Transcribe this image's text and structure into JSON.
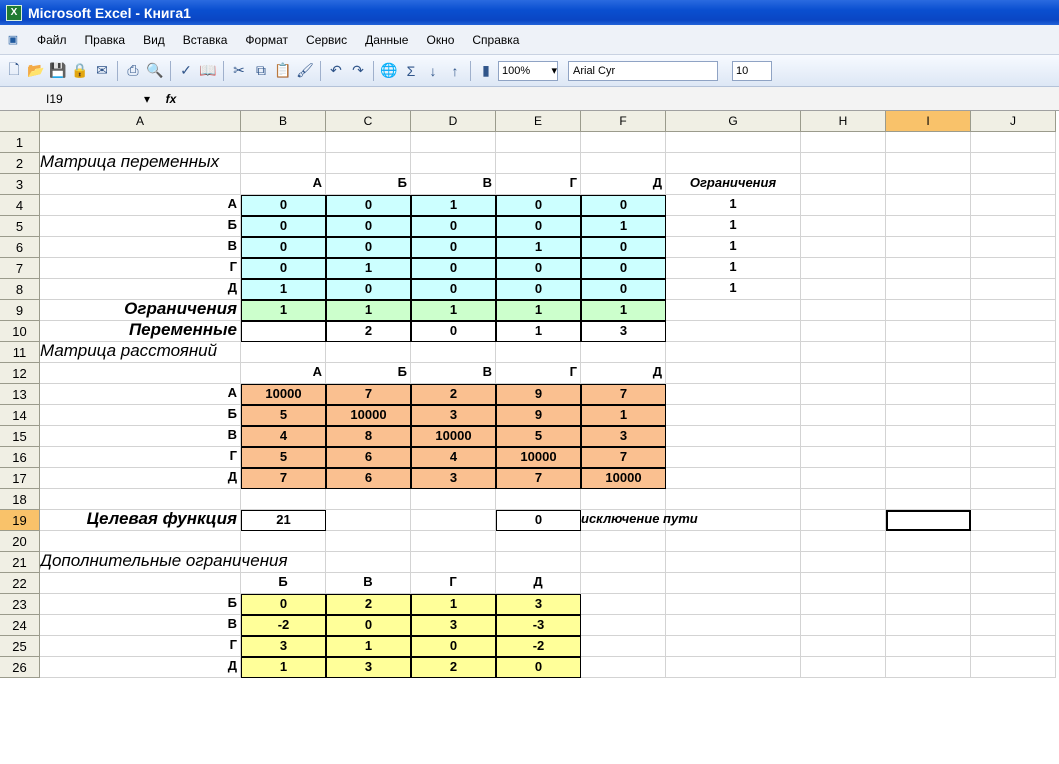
{
  "window": {
    "title": "Microsoft Excel - Книга1"
  },
  "menu": [
    "Файл",
    "Правка",
    "Вид",
    "Вставка",
    "Формат",
    "Сервис",
    "Данные",
    "Окно",
    "Справка"
  ],
  "toolbar": {
    "zoom": "100%",
    "font": "Arial Cyr",
    "font_size": "10"
  },
  "formula_bar": {
    "cell_ref": "I19",
    "fx": "fx",
    "formula": ""
  },
  "columns": [
    "A",
    "B",
    "C",
    "D",
    "E",
    "F",
    "G",
    "H",
    "I",
    "J"
  ],
  "rows": [
    "1",
    "2",
    "3",
    "4",
    "5",
    "6",
    "7",
    "8",
    "9",
    "10",
    "11",
    "12",
    "13",
    "14",
    "15",
    "16",
    "17",
    "18",
    "19",
    "20",
    "21",
    "22",
    "23",
    "24",
    "25",
    "26"
  ],
  "selected": {
    "column": "I",
    "row": "19"
  },
  "sheet": {
    "t_vars": "Матрица переменных",
    "t_dist": "Матрица расстояний",
    "t_extra": "Дополнительные ограничения",
    "hdr": [
      "А",
      "Б",
      "В",
      "Г",
      "Д"
    ],
    "hdr_extra": [
      "Б",
      "В",
      "Г",
      "Д"
    ],
    "label_constraints": "Ограничения",
    "label_variables": "Переменные",
    "label_objective": "Целевая функция",
    "label_exclusion": "исключение пути",
    "vars": [
      [
        "0",
        "0",
        "1",
        "0",
        "0"
      ],
      [
        "0",
        "0",
        "0",
        "0",
        "1"
      ],
      [
        "0",
        "0",
        "0",
        "1",
        "0"
      ],
      [
        "0",
        "1",
        "0",
        "0",
        "0"
      ],
      [
        "1",
        "0",
        "0",
        "0",
        "0"
      ]
    ],
    "row_constraints": [
      "1",
      "1",
      "1",
      "1",
      "1"
    ],
    "col_constraints": [
      "1",
      "1",
      "1",
      "1",
      "1"
    ],
    "variables": [
      "",
      "2",
      "0",
      "1",
      "3"
    ],
    "dist": [
      [
        "10000",
        "7",
        "2",
        "9",
        "7"
      ],
      [
        "5",
        "10000",
        "3",
        "9",
        "1"
      ],
      [
        "4",
        "8",
        "10000",
        "5",
        "3"
      ],
      [
        "5",
        "6",
        "4",
        "10000",
        "7"
      ],
      [
        "7",
        "6",
        "3",
        "7",
        "10000"
      ]
    ],
    "objective": "21",
    "exclusion": "0",
    "extra": [
      [
        "0",
        "2",
        "1",
        "3"
      ],
      [
        "-2",
        "0",
        "3",
        "-3"
      ],
      [
        "3",
        "1",
        "0",
        "-2"
      ],
      [
        "1",
        "3",
        "2",
        "0"
      ]
    ],
    "extra_rows": [
      "Б",
      "В",
      "Г",
      "Д"
    ]
  }
}
